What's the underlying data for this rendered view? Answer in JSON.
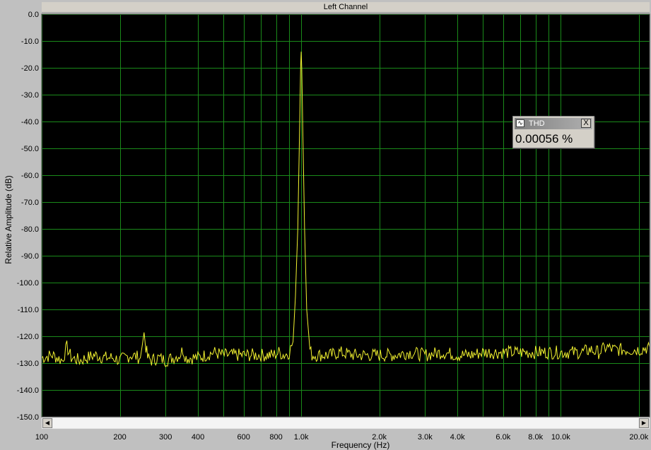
{
  "window": {
    "title": "Left Channel"
  },
  "thd": {
    "title": "THD",
    "value": "0.00056 %",
    "close_glyph": "X"
  },
  "scrollbar": {
    "left_arrow": "◀",
    "right_arrow": "▶"
  },
  "colors": {
    "background": "#000000",
    "grid": "#1a8a1a",
    "trace": "#f2f230",
    "frame": "#c0c0c0"
  },
  "chart_data": {
    "type": "line",
    "title": "Left Channel",
    "xlabel": "Frequency (Hz)",
    "ylabel": "Relative Amplitude (dB)",
    "x_scale": "log",
    "xlim": [
      100,
      22000
    ],
    "ylim": [
      -150,
      0
    ],
    "grid": true,
    "x_ticks": [
      100,
      200,
      300,
      400,
      600,
      800,
      1000,
      2000,
      3000,
      4000,
      6000,
      8000,
      10000,
      20000
    ],
    "x_tick_labels": [
      "100",
      "200",
      "300",
      "400",
      "600",
      "800",
      "1.0k",
      "2.0k",
      "3.0k",
      "4.0k",
      "6.0k",
      "8.0k",
      "10.0k",
      "20.0k"
    ],
    "y_ticks": [
      0,
      -10,
      -20,
      -30,
      -40,
      -50,
      -60,
      -70,
      -80,
      -90,
      -100,
      -110,
      -120,
      -130,
      -140,
      -150
    ],
    "y_tick_labels": [
      "0.0",
      "-10.0",
      "-20.0",
      "-30.0",
      "-40.0",
      "-50.0",
      "-60.0",
      "-70.0",
      "-80.0",
      "-90.0",
      "-100.0",
      "-110.0",
      "-120.0",
      "-130.0",
      "-140.0",
      "-150.0"
    ],
    "series": [
      {
        "x": [
          100,
          110,
          120,
          125,
          130,
          140,
          150,
          160,
          175,
          190,
          200,
          220,
          240,
          248,
          252,
          256,
          265,
          280,
          300,
          320,
          340,
          350,
          360,
          380,
          400,
          430,
          460,
          500,
          540,
          580,
          620,
          660,
          700,
          740,
          780,
          820,
          860,
          900,
          930,
          950,
          970,
          985,
          995,
          1000,
          1005,
          1015,
          1030,
          1050,
          1080,
          1100,
          1200,
          1300,
          1400,
          1600,
          1800,
          2000,
          2300,
          2600,
          3000,
          3500,
          4000,
          4500,
          5000,
          6000,
          7000,
          8000,
          9000,
          10000,
          12000,
          13000,
          14000,
          15000,
          16000,
          18000,
          20000,
          22000
        ],
        "y": [
          -128,
          -127,
          -129,
          -124,
          -128,
          -129,
          -128,
          -127,
          -128,
          -128,
          -129,
          -127,
          -128,
          -119,
          -124,
          -128,
          -129,
          -128,
          -129,
          -128,
          -127,
          -125,
          -128,
          -128,
          -128,
          -127,
          -126,
          -127,
          -127,
          -127,
          -127,
          -127,
          -127,
          -127,
          -127,
          -126,
          -127,
          -126,
          -122,
          -105,
          -80,
          -45,
          -20,
          -14,
          -20,
          -45,
          -80,
          -110,
          -125,
          -127,
          -127,
          -127,
          -126,
          -127,
          -127,
          -127,
          -127,
          -126,
          -127,
          -126,
          -127,
          -127,
          -126,
          -126,
          -126,
          -126,
          -126,
          -126,
          -126,
          -125,
          -126,
          -124,
          -125,
          -125,
          -125,
          -124
        ]
      }
    ]
  }
}
